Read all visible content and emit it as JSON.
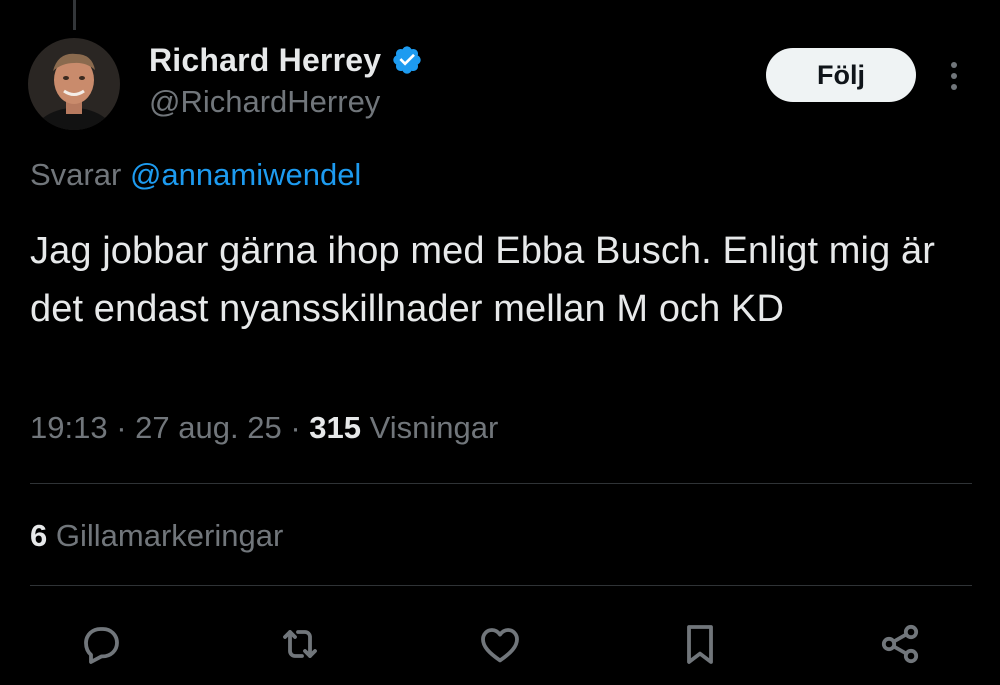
{
  "author": {
    "display_name": "Richard Herrey",
    "handle": "@RichardHerrey",
    "verified": true
  },
  "follow_button": {
    "label": "Följ"
  },
  "reply_context": {
    "prefix": "Svarar",
    "mention": "@annamiwendel"
  },
  "tweet": {
    "text": "Jag jobbar gärna ihop med Ebba Busch. Enligt mig är det endast nyansskillnader mellan M och KD"
  },
  "meta": {
    "time": "19:13",
    "separator": "·",
    "date": "27 aug. 25",
    "views_count": "315",
    "views_label": "Visningar"
  },
  "engagement": {
    "likes_count": "6",
    "likes_label": "Gillamarkeringar"
  },
  "actions": [
    "reply-icon",
    "retweet-icon",
    "like-icon",
    "bookmark-icon",
    "share-icon"
  ],
  "colors": {
    "background": "#000000",
    "text_primary": "#e7e9ea",
    "text_secondary": "#71767b",
    "accent_blue": "#1d9bf0",
    "divider": "#2f3336",
    "follow_bg": "#eff3f4"
  }
}
